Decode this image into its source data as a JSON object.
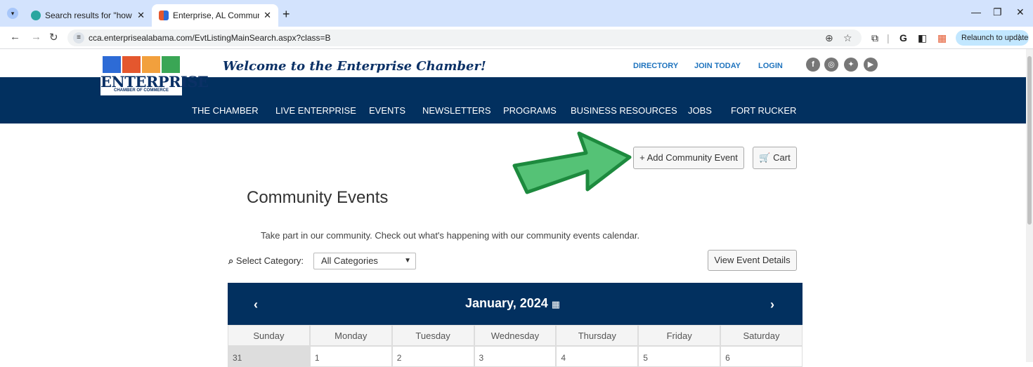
{
  "browser": {
    "tabs": [
      {
        "title": "Search results for \"how to find a",
        "active": false
      },
      {
        "title": "Enterprise, AL Community Calen",
        "active": true
      }
    ],
    "url": "cca.enterprisealabama.com/EvtListingMainSearch.aspx?class=B",
    "relaunch_label": "Relaunch to update",
    "icons": [
      "tab-search-icon",
      "back-icon",
      "forward-icon",
      "reload-icon",
      "site-info-icon",
      "zoom-icon",
      "bookmark-star-icon",
      "extensions-icon",
      "google-icon",
      "sidepanel-icon",
      "menu-icon"
    ]
  },
  "site": {
    "logo_text": "ENTERPRISE",
    "logo_sub": "CHAMBER OF COMMERCE",
    "welcome": "Welcome to the Enterprise Chamber!",
    "top_links": [
      "DIRECTORY",
      "JOIN TODAY",
      "LOGIN"
    ],
    "social": [
      "facebook-icon",
      "instagram-icon",
      "twitter-icon",
      "youtube-icon"
    ],
    "nav": [
      "THE CHAMBER",
      "LIVE ENTERPRISE",
      "EVENTS",
      "NEWSLETTERS",
      "PROGRAMS",
      "BUSINESS RESOURCES",
      "JOBS",
      "FORT RUCKER"
    ]
  },
  "content": {
    "add_event_label": "+ Add Community Event",
    "cart_label": "Cart",
    "title": "Community Events",
    "intro": "Take part in our community. Check out what's happening with our community events calendar.",
    "category_label": "Select Category:",
    "category_value": "All Categories",
    "view_details_label": "View Event Details",
    "arrow_color": "#3cb563"
  },
  "calendar": {
    "month": "January, 2024",
    "prev": "‹",
    "next": "›",
    "weekdays": [
      "Sunday",
      "Monday",
      "Tuesday",
      "Wednesday",
      "Thursday",
      "Friday",
      "Saturday"
    ],
    "first_row": [
      "31",
      "1",
      "2",
      "3",
      "4",
      "5",
      "6"
    ]
  },
  "colors": {
    "brand_navy": "#02305f",
    "link_blue": "#1e73be"
  }
}
